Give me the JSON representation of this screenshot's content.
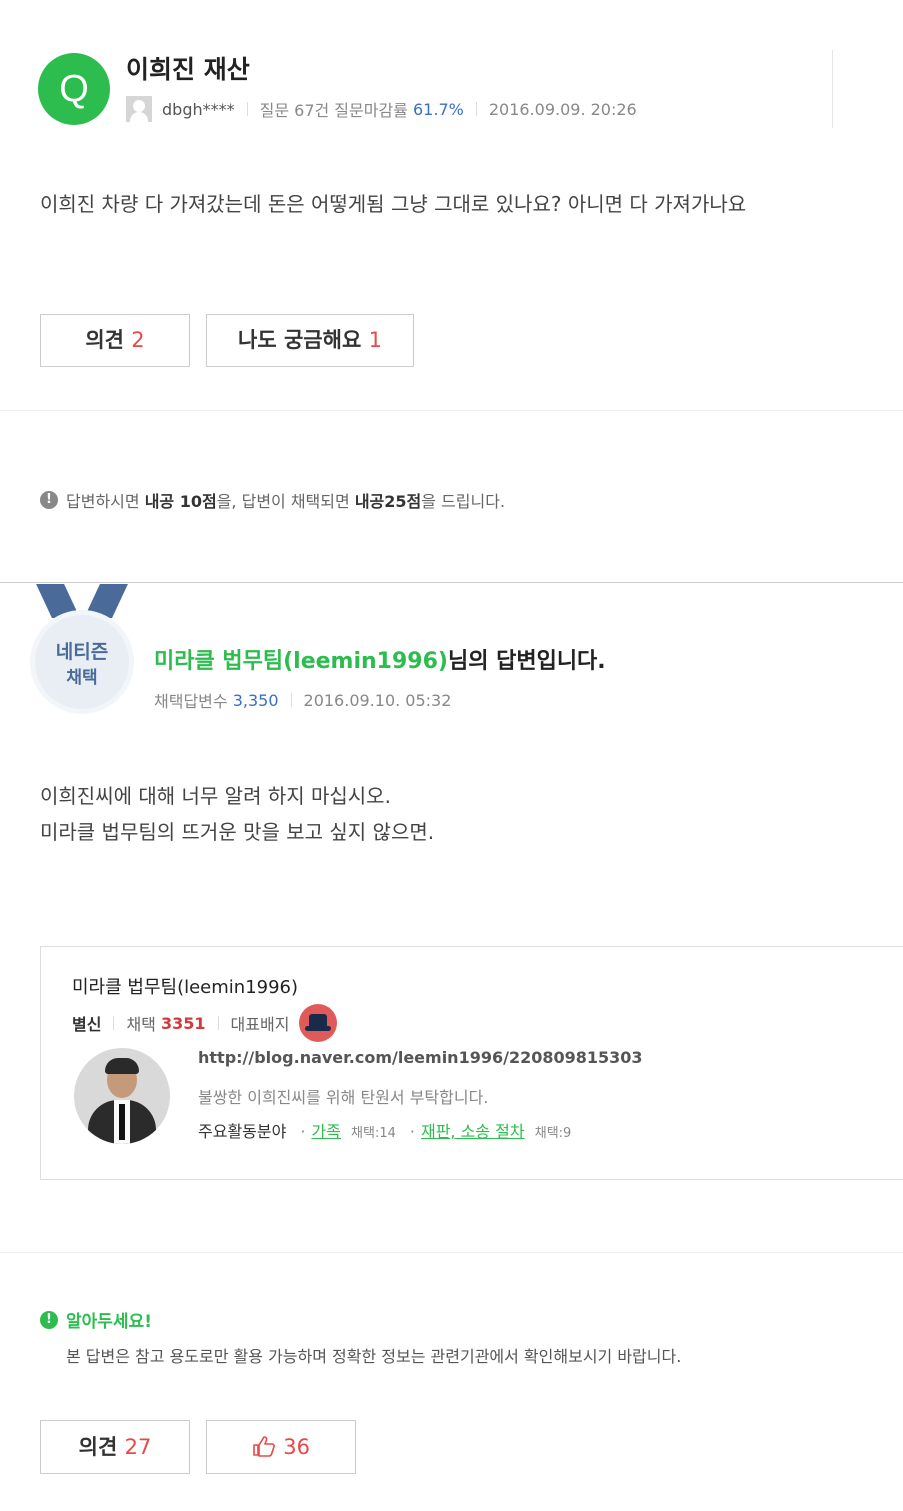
{
  "question": {
    "icon_letter": "Q",
    "title": "이희진 재산",
    "author": "dbgh****",
    "question_stats_label": "질문 67건 질문마감률",
    "close_rate": "61.7%",
    "date": "2016.09.09. 20:26",
    "body": "이희진 차량 다 가져갔는데 돈은 어떻게됨 그냥 그대로 있나요? 아니면 다 가져가나요",
    "opinion_label": "의견",
    "opinion_count": "2",
    "curious_label": "나도 궁금해요",
    "curious_count": "1"
  },
  "notice": {
    "text_1": "답변하시면",
    "bold_1": "내공 10점",
    "text_2": "을, 답변이 채택되면",
    "bold_2": "내공25점",
    "text_3": "을 드립니다."
  },
  "answer": {
    "medal_line1": "네티즌",
    "medal_line2": "채택",
    "author_name": "미라클 법무팀(leemin1996)",
    "title_suffix": "님의 답변입니다.",
    "adopted_label": "채택답변수",
    "adopted_count": "3,350",
    "date": "2016.09.10. 05:32",
    "body_line1": "이희진씨에 대해 너무 알려 하지 마십시오.",
    "body_line2": "미라클 법무팀의 뜨거운 맛을 보고 싶지 않으면."
  },
  "profile": {
    "name": "미라클 법무팀(leemin1996)",
    "level": "별신",
    "adopt_label": "채택",
    "adopt_count": "3351",
    "badge_label": "대표배지",
    "url": "http://blog.naver.com/leemin1996/220809815303",
    "intro": "불쌍한 이희진씨를 위해 탄원서 부탁합니다.",
    "area_label": "주요활동분야",
    "area1": "가족",
    "area1_count": "채택:14",
    "area2": "재판, 소송 절차",
    "area2_count": "채택:9"
  },
  "disclaimer": {
    "title": "알아두세요!",
    "text": "본 답변은 참고 용도로만 활용 가능하며 정확한 정보는 관련기관에서 확인해보시기 바랍니다."
  },
  "footer": {
    "opinion_label": "의견",
    "opinion_count": "27",
    "like_count": "36"
  },
  "colors": {
    "green": "#2dbd4f",
    "red": "#e84848",
    "blue": "#3a6fc4"
  }
}
